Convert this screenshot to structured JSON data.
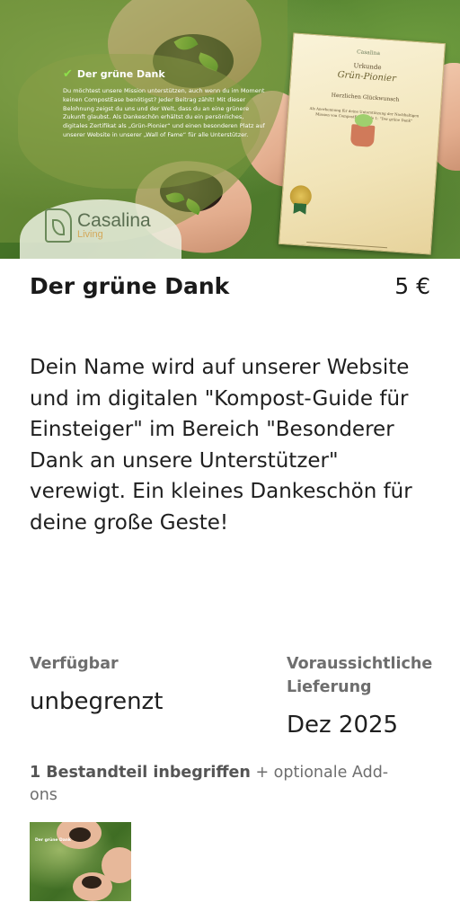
{
  "hero": {
    "title": "Der grüne Dank",
    "description": "Du möchtest unsere Mission unterstützen, auch wenn du im Moment keinen CompostEase benötigst? Jeder Beitrag zählt! Mit dieser Belohnung zeigst du uns und der Welt, dass du an eine grünere Zukunft glaubst. Als Dankeschön erhältst du ein persönliches, digitales Zertifikat als „Grün-Pionier“ und einen besonderen Platz auf unserer Website in unserer „Wall of Fame“ für alle Unterstützer.",
    "logo_name": "Casalina",
    "logo_sub": "Living",
    "certificate": {
      "logo": "Casalina",
      "heading": "Urkunde",
      "subtitle": "Grün-Pionier",
      "congrats": "Herzlichen Glückwunsch",
      "body": "Als Anerkennung für deine Unterstützung der Nachhaltigen Mission von CompostEase Stufe 1: \"Der grüne Dank\""
    },
    "colors": {
      "leaf": "#8ee04a",
      "overlay": "#789640"
    }
  },
  "product": {
    "title": "Der grüne Dank",
    "price": "5 €",
    "description": "Dein Name wird auf unserer Website und im digitalen \"Kompost-Guide für Einsteiger\" im Bereich \"Besonderer Dank an unsere Unterstützer\" verewigt. Ein kleines Dankeschön für deine große Geste!"
  },
  "availability": {
    "label": "Verfügbar",
    "value": "unbegrenzt"
  },
  "delivery": {
    "label": "Voraussichtliche Lieferung",
    "value": "Dez 2025"
  },
  "includes": {
    "bold": "1 Bestandteil inbegriffen",
    "rest": " + optionale Add-ons"
  },
  "thumbnail": {
    "title": "Der grüne Dank",
    "icon": "reward-image-thumbnail"
  }
}
